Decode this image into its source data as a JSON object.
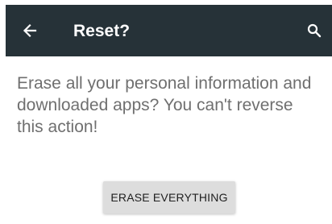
{
  "toolbar": {
    "title": "Reset?",
    "back_icon": "arrow-back-icon",
    "search_icon": "search-icon",
    "background_color": "#263238"
  },
  "content": {
    "message": "Erase all your personal information and downloaded apps? You can't reverse this action!"
  },
  "actions": {
    "erase_label": "ERASE EVERYTHING"
  }
}
